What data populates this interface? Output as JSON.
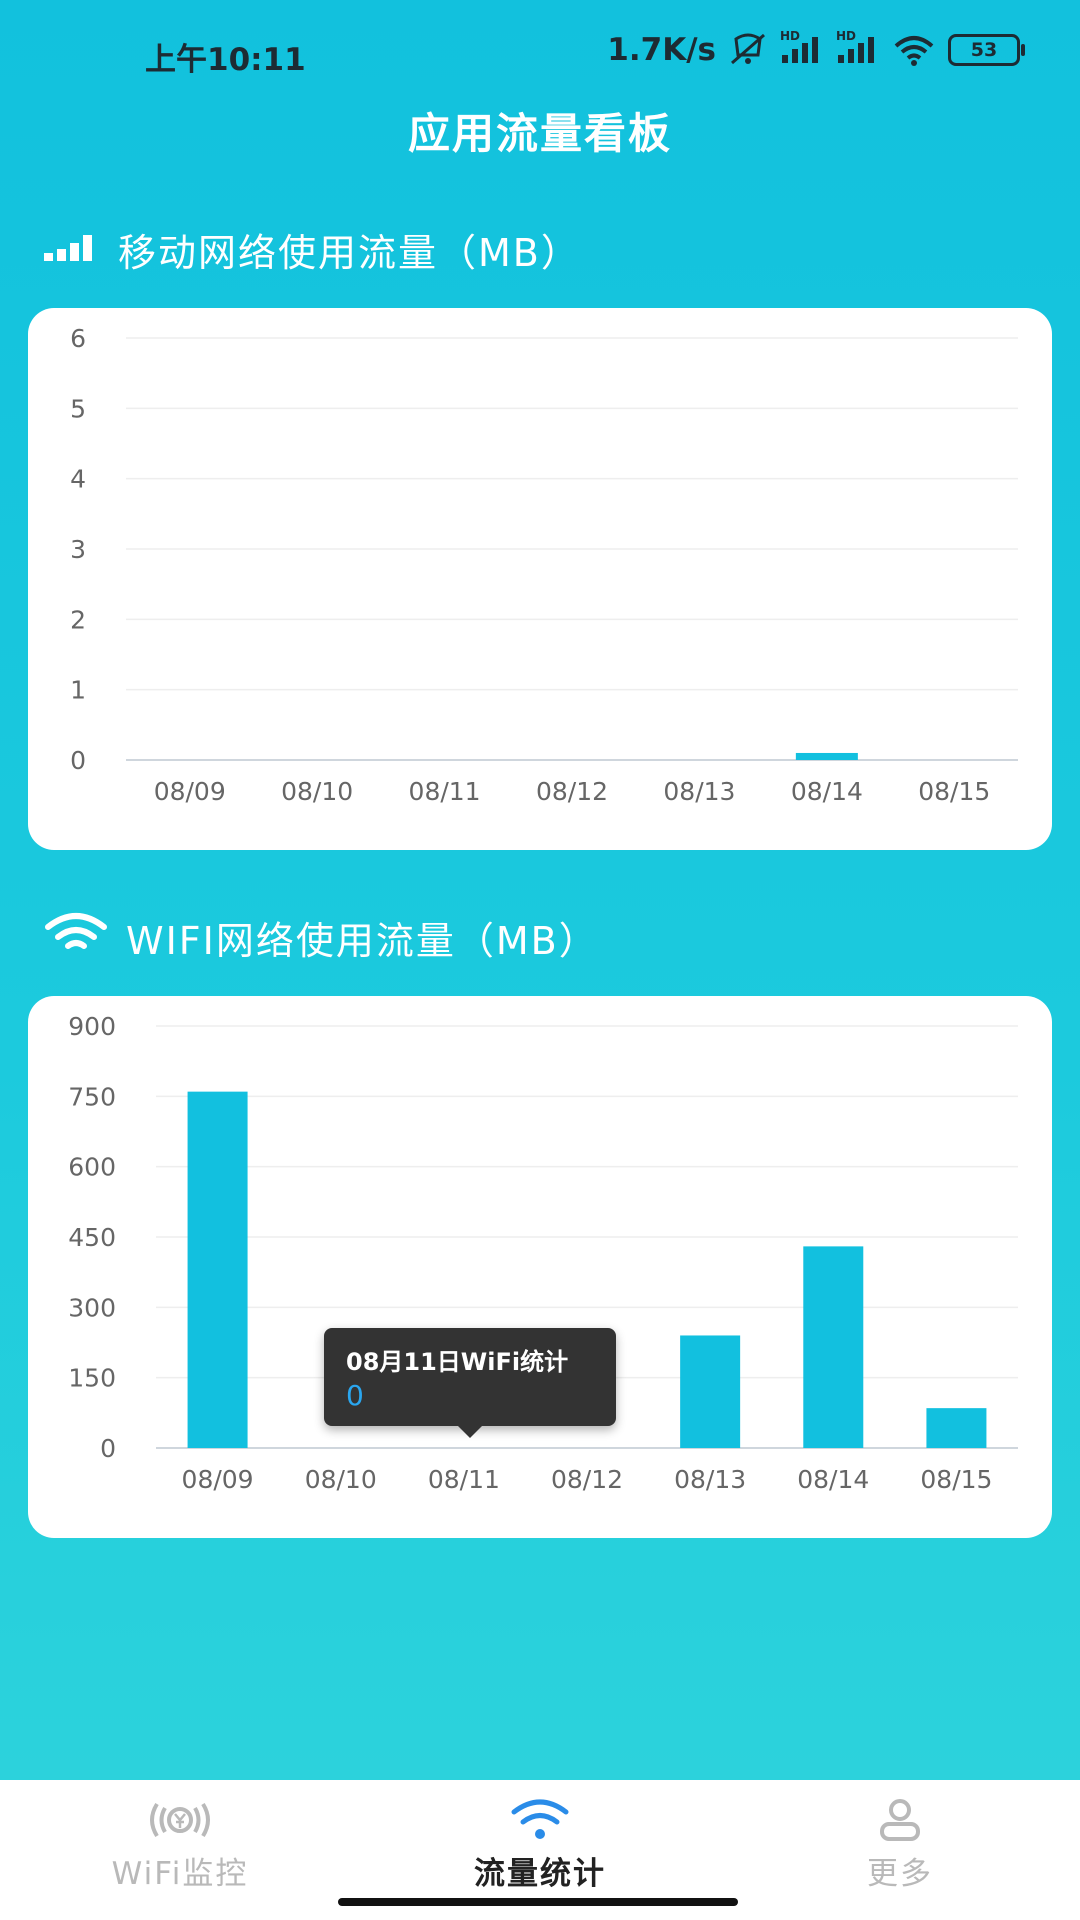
{
  "status_bar": {
    "time": "上午10:11",
    "speed": "1.7K/s",
    "signal_label_1": "HD",
    "signal_label_2": "HD",
    "battery": "53"
  },
  "header": {
    "title": "应用流量看板"
  },
  "mobile_section": {
    "title": "移动网络使用流量（MB）",
    "icon": "signal-bars-icon"
  },
  "wifi_section": {
    "title": "WIFI网络使用流量（MB）",
    "icon": "wifi-icon"
  },
  "tooltip": {
    "title": "08月11日WiFi统计",
    "value": "0"
  },
  "tabs": [
    {
      "label": "WiFi监控",
      "icon": "wifi-monitor-icon",
      "active": false
    },
    {
      "label": "流量统计",
      "icon": "wifi-icon",
      "active": true
    },
    {
      "label": "更多",
      "icon": "user-icon",
      "active": false
    }
  ],
  "colors": {
    "bar": "#12c0df",
    "accent": "#2aa6ef",
    "background": "#16c5dd"
  },
  "chart_data": [
    {
      "type": "bar",
      "title": "移动网络使用流量（MB）",
      "categories": [
        "08/09",
        "08/10",
        "08/11",
        "08/12",
        "08/13",
        "08/14",
        "08/15"
      ],
      "values": [
        0,
        0,
        0,
        0,
        0,
        0.1,
        0
      ],
      "yticks": [
        "0",
        "1",
        "2",
        "3",
        "4",
        "5",
        "6"
      ],
      "ylim": [
        0,
        6
      ],
      "grid": true
    },
    {
      "type": "bar",
      "title": "WIFI网络使用流量（MB）",
      "categories": [
        "08/09",
        "08/10",
        "08/11",
        "08/12",
        "08/13",
        "08/14",
        "08/15"
      ],
      "values": [
        760,
        0,
        0,
        0,
        240,
        430,
        85
      ],
      "yticks": [
        "0",
        "150",
        "300",
        "450",
        "600",
        "750",
        "900"
      ],
      "ylim": [
        0,
        900
      ],
      "grid": true
    }
  ]
}
